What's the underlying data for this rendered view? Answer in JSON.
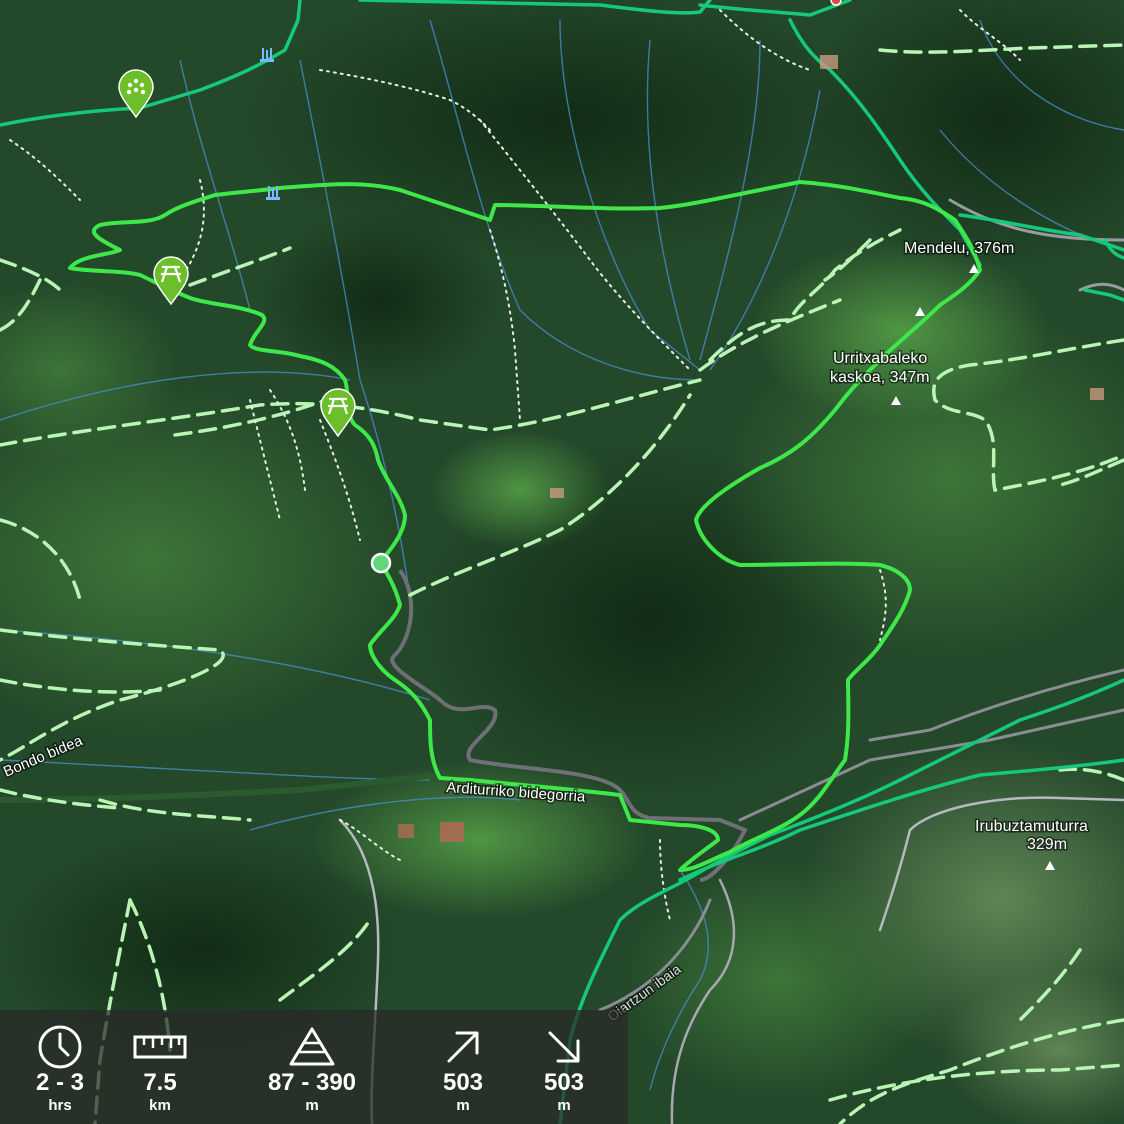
{
  "map": {
    "peaks": [
      {
        "name": "Mendelu, 376m"
      },
      {
        "name_line1": "Urritxabaleko",
        "name_line2": "kaskoa, 347m"
      },
      {
        "name_line1": "Irubuztamuturra",
        "name_line2": "329m"
      }
    ],
    "roads": {
      "bikeway": "Arditurriko bidegorria",
      "bondo": "Bondo bidea",
      "river": "Oiartzun ibaia"
    },
    "colors": {
      "route": "#3ee84a",
      "trail_green": "#16c87a",
      "dashed_trail": "#b9f5b5",
      "dotted_path": "#e6f0e0",
      "road_gray": "#8c8c95",
      "water": "#4a8fd0",
      "poi_marker": "#6cbf2a"
    },
    "pois": [
      {
        "type": "viewpoint",
        "icon": "viewpoint-icon"
      },
      {
        "type": "picnic",
        "icon": "picnic-table-icon"
      },
      {
        "type": "picnic",
        "icon": "picnic-table-icon"
      },
      {
        "type": "waterfall",
        "icon": "waterfall-icon"
      },
      {
        "type": "waterfall",
        "icon": "waterfall-icon"
      }
    ]
  },
  "stats": [
    {
      "icon": "clock-icon",
      "value": "2 - 3",
      "unit": "hrs"
    },
    {
      "icon": "ruler-icon",
      "value": "7.5",
      "unit": "km"
    },
    {
      "icon": "elevation-icon",
      "value": "87 - 390",
      "unit": "m"
    },
    {
      "icon": "ascent-arrow-icon",
      "value": "503",
      "unit": "m"
    },
    {
      "icon": "descent-arrow-icon",
      "value": "503",
      "unit": "m"
    }
  ]
}
